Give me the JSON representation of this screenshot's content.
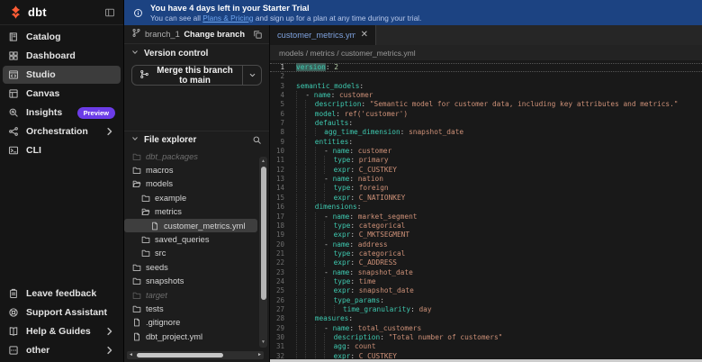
{
  "colors": {
    "brand_orange": "#ff5c35",
    "banner_blue": "#1c4382",
    "link_blue": "#6fa6ef",
    "badge_purple": "#6c3ce8",
    "active_item_gray": "#3c3c3c",
    "code_key_teal": "#3ec9b0",
    "code_value_orange": "#ce9178",
    "code_number_green": "#b5cea8"
  },
  "sidebar": {
    "logo_text": "dbt",
    "items": [
      {
        "label": "Catalog",
        "icon": "catalog-icon"
      },
      {
        "label": "Dashboard",
        "icon": "dashboard-icon"
      },
      {
        "label": "Studio",
        "icon": "studio-icon",
        "active": true
      },
      {
        "label": "Canvas",
        "icon": "canvas-icon"
      },
      {
        "label": "Insights",
        "icon": "insights-icon",
        "badge": "Preview"
      },
      {
        "label": "Orchestration",
        "icon": "orchestration-icon",
        "chevron": true
      },
      {
        "label": "CLI",
        "icon": "cli-icon"
      }
    ],
    "bottom_items": [
      {
        "label": "Leave feedback",
        "icon": "feedback-icon"
      },
      {
        "label": "Support Assistant",
        "icon": "support-icon"
      },
      {
        "label": "Help & Guides",
        "icon": "help-icon",
        "chevron": true
      },
      {
        "label": "other",
        "icon": "other-icon",
        "chevron": true
      }
    ]
  },
  "banner": {
    "title": "You have 4 days left in your Starter Trial",
    "body_prefix": "You can see all ",
    "link": "Plans & Pricing",
    "body_suffix": " and sign up for a plan at any time during your trial."
  },
  "vcs": {
    "branch_name": "branch_1",
    "change_branch_label": "Change branch",
    "section_title": "Version control",
    "merge_button_label": "Merge this branch to main"
  },
  "explorer": {
    "section_title": "File explorer",
    "items": [
      {
        "name": "dbt_packages",
        "type": "folder",
        "indent": 0,
        "dim": true
      },
      {
        "name": "macros",
        "type": "folder",
        "indent": 0
      },
      {
        "name": "models",
        "type": "folder-open",
        "indent": 0
      },
      {
        "name": "example",
        "type": "folder",
        "indent": 1
      },
      {
        "name": "metrics",
        "type": "folder-open",
        "indent": 1
      },
      {
        "name": "customer_metrics.yml",
        "type": "file",
        "indent": 2,
        "selected": true
      },
      {
        "name": "saved_queries",
        "type": "folder",
        "indent": 1
      },
      {
        "name": "src",
        "type": "folder",
        "indent": 1
      },
      {
        "name": "seeds",
        "type": "folder",
        "indent": 0
      },
      {
        "name": "snapshots",
        "type": "folder",
        "indent": 0
      },
      {
        "name": "target",
        "type": "folder",
        "indent": 0,
        "dim": true
      },
      {
        "name": "tests",
        "type": "folder",
        "indent": 0
      },
      {
        "name": ".gitignore",
        "type": "file",
        "indent": 0
      },
      {
        "name": "dbt_project.yml",
        "type": "file",
        "indent": 0
      }
    ]
  },
  "editor": {
    "tab_label": "customer_metrics.yml",
    "breadcrumb": "models / metrics / customer_metrics.yml",
    "lines": [
      {
        "n": 1,
        "ind": 0,
        "cur": true,
        "t": [
          [
            "k sel",
            "version"
          ],
          [
            "p",
            ": "
          ],
          [
            "n",
            "2"
          ]
        ]
      },
      {
        "n": 2,
        "ind": 0,
        "t": []
      },
      {
        "n": 3,
        "ind": 0,
        "t": [
          [
            "k",
            "semantic_models"
          ],
          [
            "p",
            ":"
          ]
        ]
      },
      {
        "n": 4,
        "ind": 2,
        "t": [
          [
            "p",
            "- "
          ],
          [
            "k",
            "name"
          ],
          [
            "p",
            ": "
          ],
          [
            "v",
            "customer"
          ]
        ]
      },
      {
        "n": 5,
        "ind": 4,
        "t": [
          [
            "k",
            "description"
          ],
          [
            "p",
            ": "
          ],
          [
            "s",
            "\"Semantic model for customer data, including key attributes and metrics.\""
          ]
        ]
      },
      {
        "n": 6,
        "ind": 4,
        "t": [
          [
            "k",
            "model"
          ],
          [
            "p",
            ": "
          ],
          [
            "v",
            "ref('customer')"
          ]
        ]
      },
      {
        "n": 7,
        "ind": 4,
        "t": [
          [
            "k",
            "defaults"
          ],
          [
            "p",
            ":"
          ]
        ]
      },
      {
        "n": 8,
        "ind": 6,
        "t": [
          [
            "k",
            "agg_time_dimension"
          ],
          [
            "p",
            ": "
          ],
          [
            "v",
            "snapshot_date"
          ]
        ]
      },
      {
        "n": 9,
        "ind": 4,
        "t": [
          [
            "k",
            "entities"
          ],
          [
            "p",
            ":"
          ]
        ]
      },
      {
        "n": 10,
        "ind": 6,
        "t": [
          [
            "p",
            "- "
          ],
          [
            "k",
            "name"
          ],
          [
            "p",
            ": "
          ],
          [
            "v",
            "customer"
          ]
        ]
      },
      {
        "n": 11,
        "ind": 8,
        "t": [
          [
            "k",
            "type"
          ],
          [
            "p",
            ": "
          ],
          [
            "v",
            "primary"
          ]
        ]
      },
      {
        "n": 12,
        "ind": 8,
        "t": [
          [
            "k",
            "expr"
          ],
          [
            "p",
            ": "
          ],
          [
            "v",
            "C_CUSTKEY"
          ]
        ]
      },
      {
        "n": 13,
        "ind": 6,
        "t": [
          [
            "p",
            "- "
          ],
          [
            "k",
            "name"
          ],
          [
            "p",
            ": "
          ],
          [
            "v",
            "nation"
          ]
        ]
      },
      {
        "n": 14,
        "ind": 8,
        "t": [
          [
            "k",
            "type"
          ],
          [
            "p",
            ": "
          ],
          [
            "v",
            "foreign"
          ]
        ]
      },
      {
        "n": 15,
        "ind": 8,
        "t": [
          [
            "k",
            "expr"
          ],
          [
            "p",
            ": "
          ],
          [
            "v",
            "C_NATIONKEY"
          ]
        ]
      },
      {
        "n": 16,
        "ind": 4,
        "t": [
          [
            "k",
            "dimensions"
          ],
          [
            "p",
            ":"
          ]
        ]
      },
      {
        "n": 17,
        "ind": 6,
        "t": [
          [
            "p",
            "- "
          ],
          [
            "k",
            "name"
          ],
          [
            "p",
            ": "
          ],
          [
            "v",
            "market_segment"
          ]
        ]
      },
      {
        "n": 18,
        "ind": 8,
        "t": [
          [
            "k",
            "type"
          ],
          [
            "p",
            ": "
          ],
          [
            "v",
            "categorical"
          ]
        ]
      },
      {
        "n": 19,
        "ind": 8,
        "t": [
          [
            "k",
            "expr"
          ],
          [
            "p",
            ": "
          ],
          [
            "v",
            "C_MKTSEGMENT"
          ]
        ]
      },
      {
        "n": 20,
        "ind": 6,
        "t": [
          [
            "p",
            "- "
          ],
          [
            "k",
            "name"
          ],
          [
            "p",
            ": "
          ],
          [
            "v",
            "address"
          ]
        ]
      },
      {
        "n": 21,
        "ind": 8,
        "t": [
          [
            "k",
            "type"
          ],
          [
            "p",
            ": "
          ],
          [
            "v",
            "categorical"
          ]
        ]
      },
      {
        "n": 22,
        "ind": 8,
        "t": [
          [
            "k",
            "expr"
          ],
          [
            "p",
            ": "
          ],
          [
            "v",
            "C_ADDRESS"
          ]
        ]
      },
      {
        "n": 23,
        "ind": 6,
        "t": [
          [
            "p",
            "- "
          ],
          [
            "k",
            "name"
          ],
          [
            "p",
            ": "
          ],
          [
            "v",
            "snapshot_date"
          ]
        ]
      },
      {
        "n": 24,
        "ind": 8,
        "t": [
          [
            "k",
            "type"
          ],
          [
            "p",
            ": "
          ],
          [
            "v",
            "time"
          ]
        ]
      },
      {
        "n": 25,
        "ind": 8,
        "t": [
          [
            "k",
            "expr"
          ],
          [
            "p",
            ": "
          ],
          [
            "v",
            "snapshot_date"
          ]
        ]
      },
      {
        "n": 26,
        "ind": 8,
        "t": [
          [
            "k",
            "type_params"
          ],
          [
            "p",
            ":"
          ]
        ]
      },
      {
        "n": 27,
        "ind": 10,
        "t": [
          [
            "k",
            "time_granularity"
          ],
          [
            "p",
            ": "
          ],
          [
            "v",
            "day"
          ]
        ]
      },
      {
        "n": 28,
        "ind": 4,
        "t": [
          [
            "k",
            "measures"
          ],
          [
            "p",
            ":"
          ]
        ]
      },
      {
        "n": 29,
        "ind": 6,
        "t": [
          [
            "p",
            "- "
          ],
          [
            "k",
            "name"
          ],
          [
            "p",
            ": "
          ],
          [
            "v",
            "total_customers"
          ]
        ]
      },
      {
        "n": 30,
        "ind": 8,
        "t": [
          [
            "k",
            "description"
          ],
          [
            "p",
            ": "
          ],
          [
            "s",
            "\"Total number of customers\""
          ]
        ]
      },
      {
        "n": 31,
        "ind": 8,
        "t": [
          [
            "k",
            "agg"
          ],
          [
            "p",
            ": "
          ],
          [
            "v",
            "count"
          ]
        ]
      },
      {
        "n": 32,
        "ind": 8,
        "t": [
          [
            "k",
            "expr"
          ],
          [
            "p",
            ": "
          ],
          [
            "v",
            "C_CUSTKEY"
          ]
        ]
      }
    ]
  }
}
